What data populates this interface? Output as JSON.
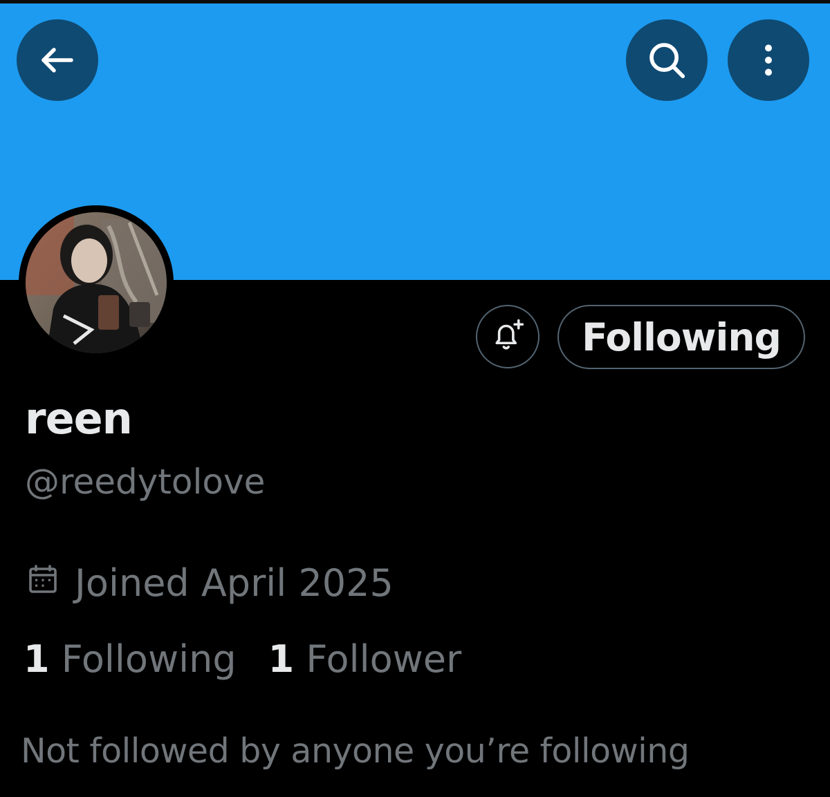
{
  "header": {
    "banner_color": "#1d9bf0",
    "back_icon": "arrow-left-icon",
    "search_icon": "search-icon",
    "more_icon": "more-vertical-icon"
  },
  "profile": {
    "display_name": "reen",
    "handle": "@reedytolove",
    "joined_icon": "calendar-icon",
    "joined": "Joined April 2025",
    "following_count": "1",
    "following_label": "Following",
    "followers_count": "1",
    "followers_label": "Follower",
    "not_followed_text": "Not followed by anyone you’re following"
  },
  "actions": {
    "notify_icon": "bell-plus-icon",
    "follow_state_label": "Following"
  },
  "colors": {
    "background": "#000000",
    "primary_text": "#e7e9ea",
    "secondary_text": "#71767b",
    "button_border": "#536471",
    "header_button_bg": "#0f4a72"
  }
}
